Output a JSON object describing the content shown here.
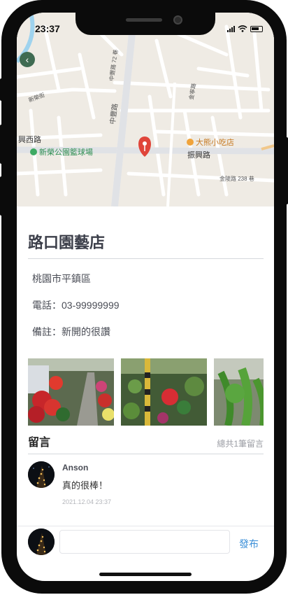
{
  "status_bar": {
    "time": "23:37"
  },
  "map": {
    "back_icon": "chevron-left-icon",
    "pin_icon": "location-pin-icon",
    "labels": {
      "road_zhongfeng": "中豐路",
      "road_zhenxing": "振興路",
      "road_xingxi": "興西路",
      "poi_store": "大熊小吃店",
      "poi_park": "新榮公園籃球場",
      "road_jinlong": "金陵路 238 巷",
      "road_72": "中豐路 72 巷",
      "road_xinrong": "新榮街",
      "road_jinning": "金寧路"
    }
  },
  "store": {
    "name": "路口園藝店",
    "address": "桃園市平鎮區",
    "phone": "電話：03-99999999",
    "note": "備註：新開的很讚"
  },
  "comments": {
    "title": "留言",
    "count_text": "總共1筆留言",
    "items": [
      {
        "author": "Anson",
        "text": "真的很棒！",
        "time": "2021.12.04 23:37"
      }
    ]
  },
  "composer": {
    "input_value": "",
    "placeholder": "",
    "publish_label": "發布"
  },
  "colors": {
    "accent": "#3b8fd8",
    "title": "#3c3f4a",
    "pin": "#e0453a"
  }
}
